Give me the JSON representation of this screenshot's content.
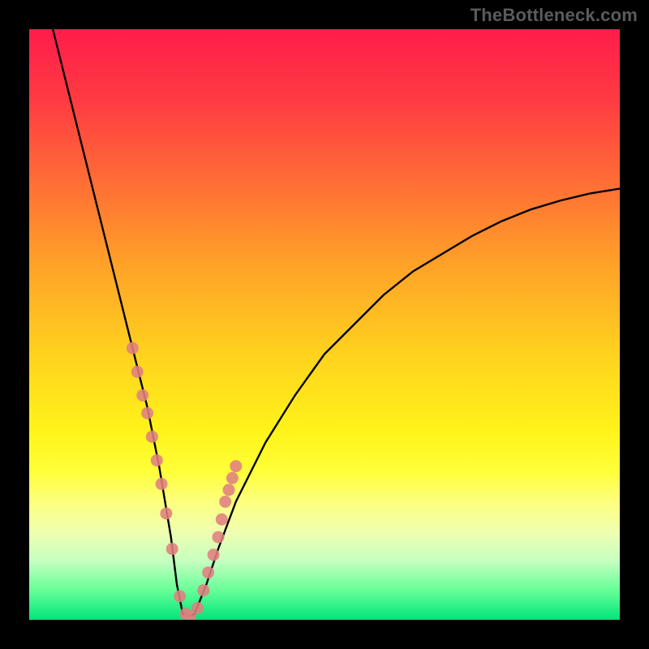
{
  "watermark": "TheBottleneck.com",
  "chart_data": {
    "type": "line",
    "title": "",
    "xlabel": "",
    "ylabel": "",
    "xlim": [
      0,
      100
    ],
    "ylim": [
      0,
      100
    ],
    "grid": false,
    "legend": false,
    "series": [
      {
        "name": "curve",
        "color": "#000000",
        "x": [
          4,
          6,
          8,
          10,
          12,
          14,
          16,
          18,
          20,
          22,
          24,
          25,
          26,
          27,
          28,
          30,
          32,
          35,
          40,
          45,
          50,
          55,
          60,
          65,
          70,
          75,
          80,
          85,
          90,
          95,
          100
        ],
        "y": [
          100,
          92,
          84,
          76,
          68,
          60,
          52,
          44,
          36,
          26,
          14,
          6,
          1,
          0.5,
          1,
          6,
          12,
          20,
          30,
          38,
          45,
          50,
          55,
          59,
          62,
          65,
          67.5,
          69.5,
          71,
          72.2,
          73
        ]
      }
    ],
    "markers": [
      {
        "name": "left-cluster",
        "color": "#e07f80",
        "x": [
          17.5,
          18.3,
          19.2,
          20.0,
          20.8,
          21.6,
          22.4,
          23.2,
          24.2,
          25.5,
          26.5,
          27.2
        ],
        "y": [
          46,
          42,
          38,
          35,
          31,
          27,
          23,
          18,
          12,
          4,
          1,
          0.6
        ]
      },
      {
        "name": "right-cluster",
        "color": "#e07f80",
        "x": [
          28.5,
          29.5,
          30.3,
          31.2,
          32.0,
          32.6,
          33.2,
          33.8,
          34.4,
          35.0
        ],
        "y": [
          2,
          5,
          8,
          11,
          14,
          17,
          20,
          22,
          24,
          26
        ]
      }
    ]
  }
}
